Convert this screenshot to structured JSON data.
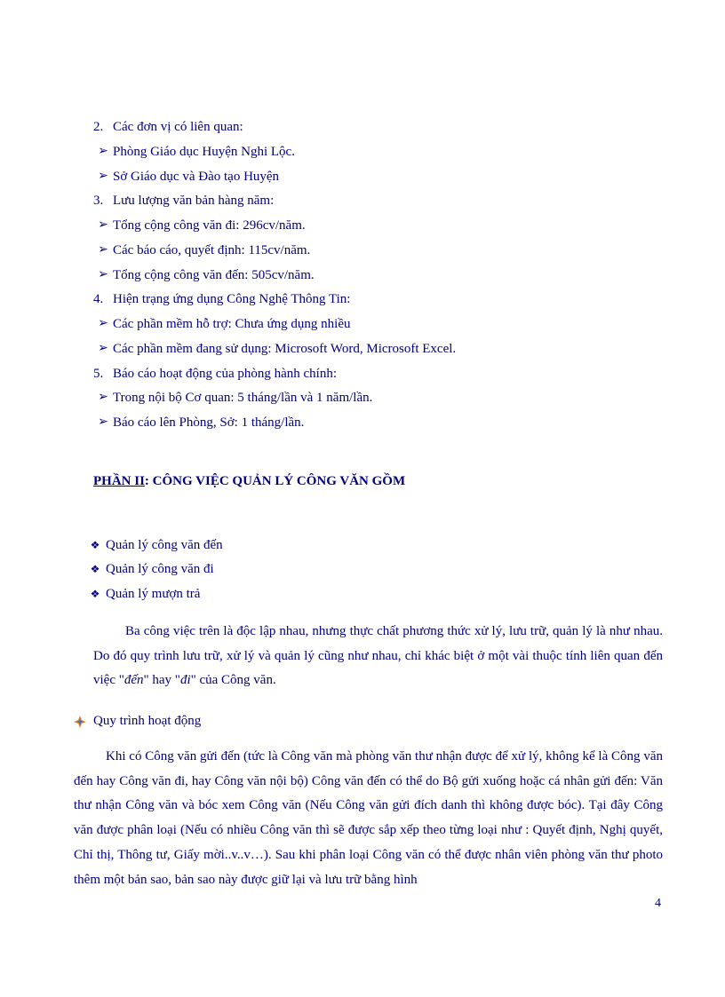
{
  "list": [
    {
      "marker": "2.",
      "type": "num",
      "text": "Các đơn vị có liên quan:"
    },
    {
      "marker": "➢",
      "type": "arrow",
      "text": "Phòng Giáo dục Huyện Nghi Lộc."
    },
    {
      "marker": "➢",
      "type": "arrow",
      "text": "Sở Giáo dục và Đào tạo Huyện"
    },
    {
      "marker": "3.",
      "type": "num",
      "text": "Lưu lượng văn bản hàng năm:"
    },
    {
      "marker": "➢",
      "type": "arrow",
      "text": "Tổng cộng công văn đi: 296cv/năm."
    },
    {
      "marker": "➢",
      "type": "arrow",
      "text": "Các báo cáo, quyết định: 115cv/năm."
    },
    {
      "marker": "➢",
      "type": "arrow",
      "text": "Tổng cộng công văn đến: 505cv/năm."
    },
    {
      "marker": "4.",
      "type": "num",
      "text": "Hiện trạng ứng dụng Công Nghệ Thông Tin:"
    },
    {
      "marker": "➢",
      "type": "arrow",
      "text": "Các phần mềm hỗ trợ: Chưa ứng dụng nhiều"
    },
    {
      "marker": "➢",
      "type": "arrow",
      "text": "Các phần mềm đang sử dụng:  Microsoft Word, Microsoft Excel."
    },
    {
      "marker": "5.",
      "type": "num",
      "text": "Báo cáo hoạt động của phòng hành chính:"
    },
    {
      "marker": "➢",
      "type": "arrow",
      "text": "Trong nội bộ Cơ quan: 5 tháng/lần và 1 năm/lần."
    },
    {
      "marker": "➢",
      "type": "arrow",
      "text": "Báo cáo lên Phòng, Sở: 1 tháng/lần."
    }
  ],
  "heading": {
    "label": "PHẦN II",
    "sep": ": ",
    "title": "CÔNG VIỆC QUẢN LÝ CÔNG VĂN GỒM"
  },
  "diamonds": [
    "Quản lý công văn đến",
    "Quản lý công văn đi",
    "Quản lý mượn trả"
  ],
  "para1_pre": "Ba công việc trên là độc lập nhau, nhưng thực chất phương thức xử lý, lưu trữ, quản lý là như nhau.  Do đó quy trình lưu trữ, xử lý và quản lý cũng như nhau, chỉ khác biệt ở một vài thuộc tính liên quan đến việc \"",
  "para1_em1": "đến",
  "para1_mid": "\" hay \"",
  "para1_em2": "đi",
  "para1_post": "\" của Công văn.",
  "plus_label": "Quy trình hoạt động",
  "para2": "Khi có Công văn gửi đến (tức là Công văn mà phòng văn thư nhận được để xử lý, không kể là Công văn đến hay Công văn đi, hay Công văn nội bộ) Công văn đến có thể do Bộ gửi xuống hoặc cá nhân gửi đến: Văn thư nhận Công văn và bóc xem Công văn (Nếu Công văn gửi đích danh thì không được bóc). Tại đây Công văn được phân loại (Nếu có nhiều Công văn thì sẽ được sắp xếp theo từng loại như : Quyết định, Nghị quyết, Chỉ thị, Thông tư, Giấy mời..v..v…).  Sau khi phân loại Công văn có thể được nhân viên phòng văn thư photo thêm một bản sao, bản sao này được giữ lại và lưu trữ bằng hình",
  "page_number": "4"
}
